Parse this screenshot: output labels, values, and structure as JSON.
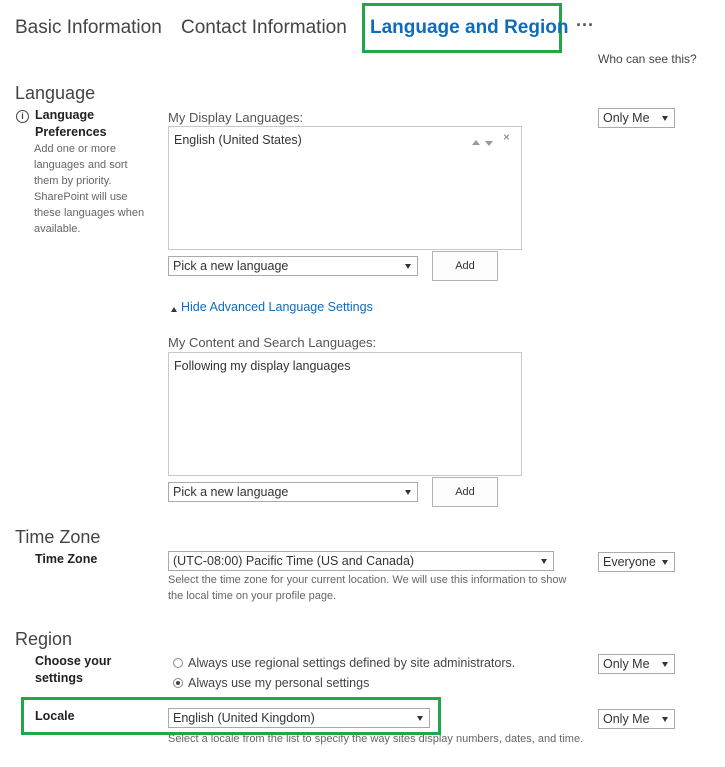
{
  "tabs": {
    "basic": "Basic Information",
    "contact": "Contact Information",
    "language": "Language and Region",
    "more": "···"
  },
  "header": {
    "who_can_see": "Who can see this?"
  },
  "language_section": {
    "title": "Language",
    "pref_label": "Language Preferences",
    "pref_desc": "Add one or more languages and sort them by priority. SharePoint will use these languages when available.",
    "display_languages_label": "My Display Languages:",
    "display_languages": [
      "English (United States)"
    ],
    "pick_placeholder": "Pick a new language",
    "add_label": "Add",
    "advanced_toggle": "Hide Advanced Language Settings",
    "content_languages_label": "My Content and Search Languages:",
    "content_languages_text": "Following my display languages",
    "content_pick_placeholder": "Pick a new language",
    "content_add_label": "Add",
    "privacy": "Only Me"
  },
  "timezone_section": {
    "title": "Time Zone",
    "label": "Time Zone",
    "value": "(UTC-08:00) Pacific Time (US and Canada)",
    "help": "Select the time zone for your current location. We will use this information to show the local time on your profile page.",
    "privacy": "Everyone"
  },
  "region_section": {
    "title": "Region",
    "settings_label": "Choose your settings",
    "option_admin": "Always use regional settings defined by site administrators.",
    "option_personal": "Always use my personal settings",
    "selected_option": "personal",
    "settings_privacy": "Only Me",
    "locale_label": "Locale",
    "locale_value": "English (United Kingdom)",
    "locale_help": "Select a locale from the list to specify the way sites display numbers, dates, and time.",
    "locale_privacy": "Only Me"
  },
  "colors": {
    "accent": "#0f6cbd",
    "highlight": "#22a64a"
  }
}
